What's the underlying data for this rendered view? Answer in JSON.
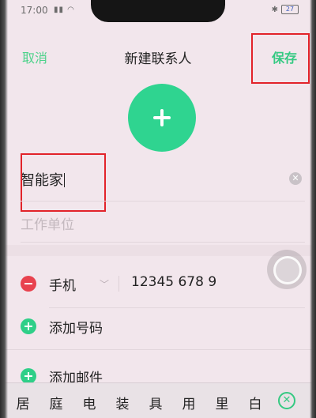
{
  "status_bar": {
    "time": "17:00",
    "signal_text": "",
    "battery_level": "27"
  },
  "nav": {
    "cancel_label": "取消",
    "title": "新建联系人",
    "save_label": "保存"
  },
  "form": {
    "name_value": "智能家",
    "company_placeholder": "工作单位",
    "phone_type": "手机",
    "phone_value": "12345 678 9",
    "add_phone_label": "添加号码",
    "add_email_label": "添加邮件"
  },
  "keyboard": {
    "candidates": [
      "居",
      "庭",
      "电",
      "装",
      "具",
      "用",
      "里",
      "白"
    ]
  },
  "colors": {
    "accent_green": "#35c982",
    "highlight_red": "#e2232a",
    "remove_red": "#e8424e"
  },
  "icons": {
    "add_photo": "plus-icon",
    "clear": "close-icon",
    "remove_phone": "minus-icon",
    "phone_type_menu": "chevron-down-icon",
    "add_phone": "plus-icon",
    "add_email": "plus-icon",
    "collapse_keyboard": "close-icon"
  }
}
